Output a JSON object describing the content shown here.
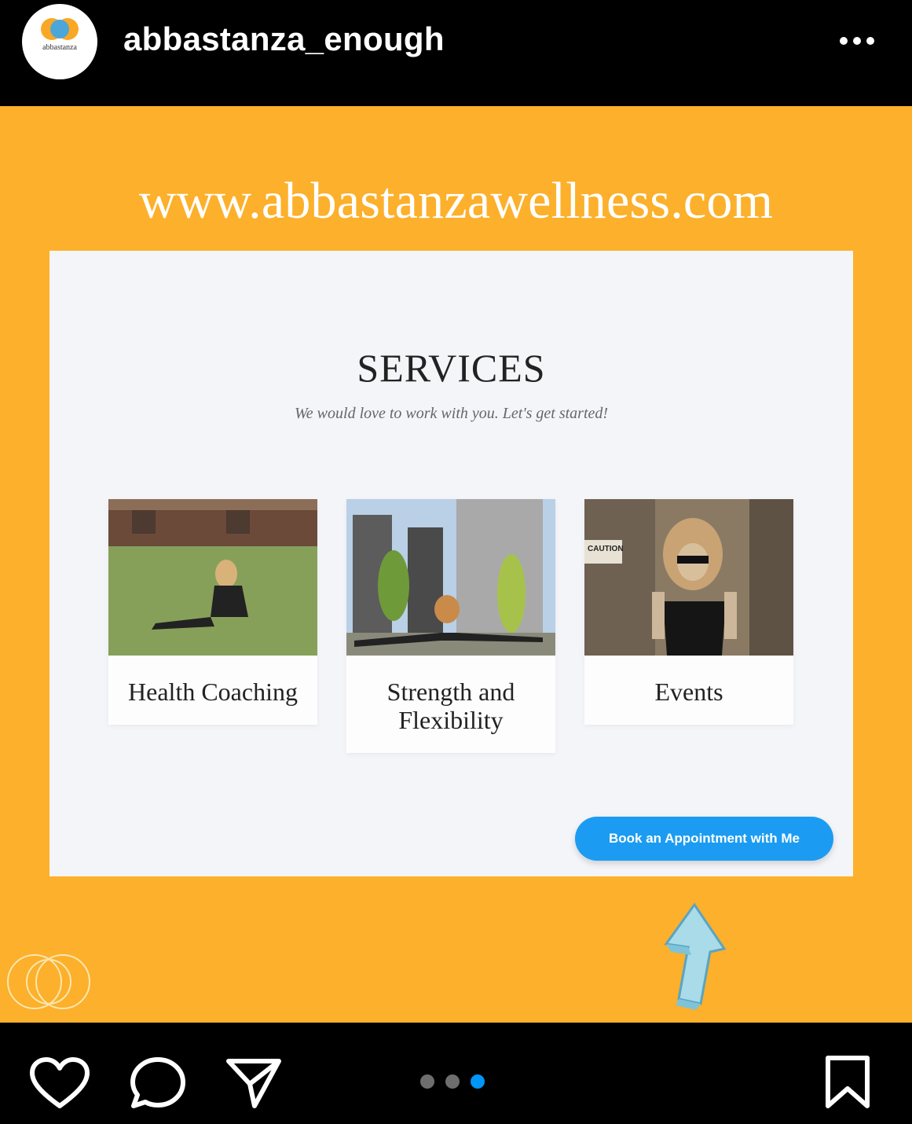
{
  "header": {
    "username": "abbastanza_enough",
    "avatar_text": "abbastanza"
  },
  "post": {
    "site_url": "www.abbastanzawellness.com",
    "page": {
      "title": "SERVICES",
      "subtitle": "We would love to work with you. Let's get started!",
      "cards": [
        {
          "label": "Health Coaching"
        },
        {
          "label": "Strength and Flexibility"
        },
        {
          "label": "Events"
        }
      ],
      "book_button": "Book an Appointment with Me",
      "caution_sign": "CAUTION"
    }
  },
  "carousel": {
    "total": 3,
    "active_index": 2
  },
  "colors": {
    "background": "#fcb02b",
    "button": "#1b9cf2",
    "active_dot": "#0095f6"
  },
  "icons": [
    "more-icon",
    "heart-icon",
    "comment-icon",
    "share-icon",
    "bookmark-icon",
    "arrow-up-icon"
  ]
}
